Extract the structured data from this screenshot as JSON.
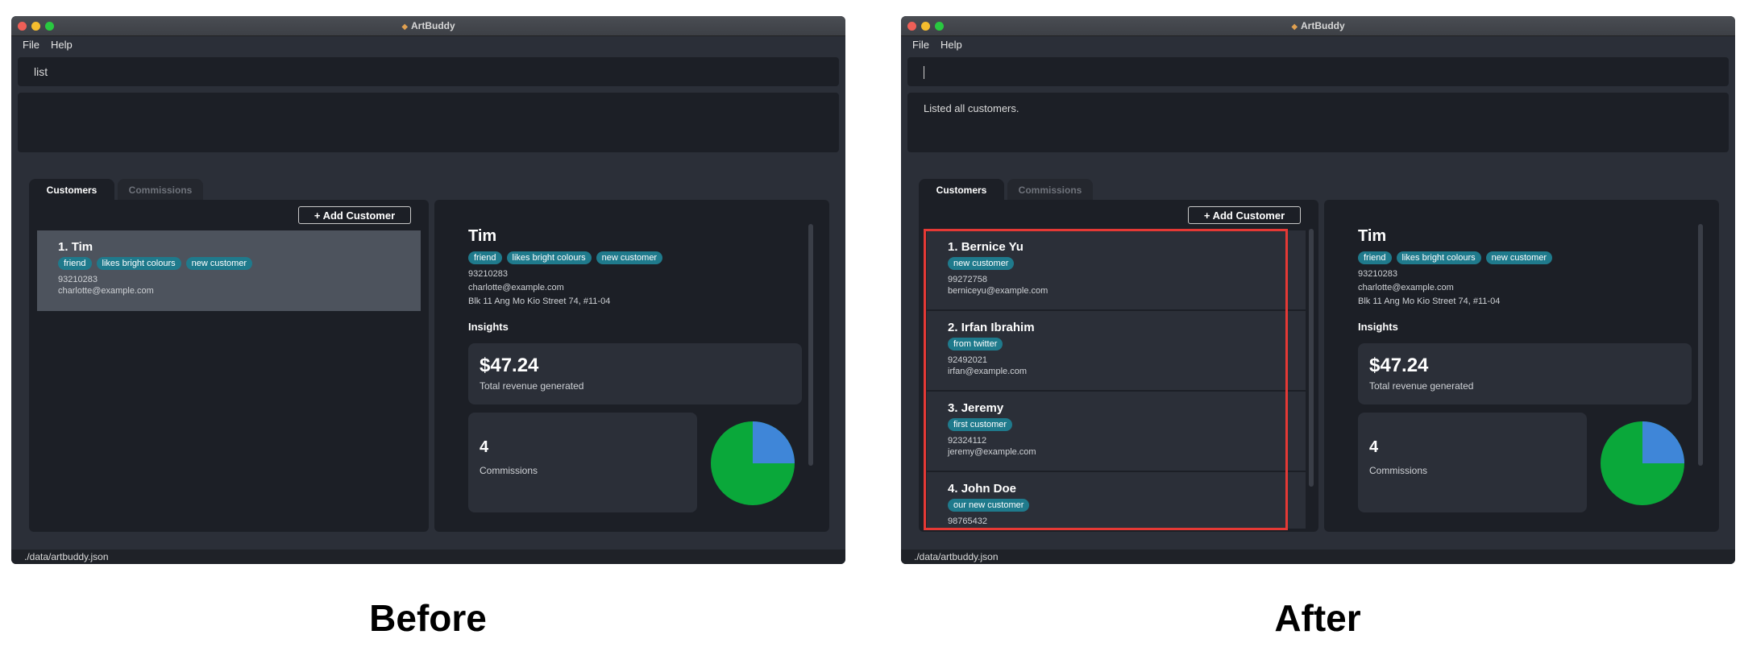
{
  "window_title": "ArtBuddy",
  "menu": [
    "File",
    "Help"
  ],
  "tabs": [
    "Customers",
    "Commissions"
  ],
  "add_customer": "+ Add Customer",
  "status": "./data/artbuddy.json",
  "before": {
    "caption": "Before",
    "command": "list",
    "result": "",
    "customers": [
      {
        "index": "1.",
        "name": "Tim",
        "tags": [
          "friend",
          "likes bright colours",
          "new customer"
        ],
        "phone": "93210283",
        "email": "charlotte@example.com"
      }
    ]
  },
  "after": {
    "caption": "After",
    "command": "",
    "result": "Listed all customers.",
    "customers": [
      {
        "index": "1.",
        "name": "Bernice Yu",
        "tags": [
          "new customer"
        ],
        "phone": "99272758",
        "email": "berniceyu@example.com"
      },
      {
        "index": "2.",
        "name": "Irfan Ibrahim",
        "tags": [
          "from twitter"
        ],
        "phone": "92492021",
        "email": "irfan@example.com"
      },
      {
        "index": "3.",
        "name": "Jeremy",
        "tags": [
          "first customer"
        ],
        "phone": "92324112",
        "email": "jeremy@example.com"
      },
      {
        "index": "4.",
        "name": "John Doe",
        "tags": [
          "our new customer"
        ],
        "phone": "98765432",
        "email": ""
      }
    ]
  },
  "detail": {
    "name": "Tim",
    "tags": [
      "friend",
      "likes bright colours",
      "new customer"
    ],
    "phone": "93210283",
    "email": "charlotte@example.com",
    "address": "Blk 11 Ang Mo Kio Street 74, #11-04",
    "insights_label": "Insights",
    "revenue": "$47.24",
    "revenue_label": "Total revenue generated",
    "commissions": "4",
    "commissions_label": "Commissions",
    "pie_fraction_blue": 0.25,
    "colors": {
      "pie_green": "#0aa83a",
      "pie_blue": "#3f86d8"
    }
  }
}
